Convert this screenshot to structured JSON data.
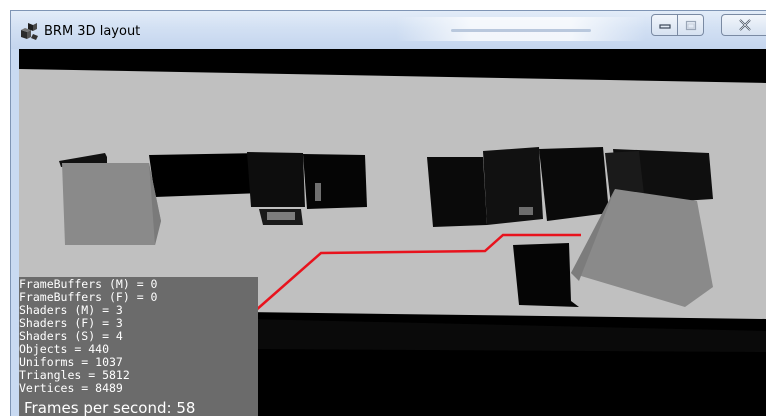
{
  "window": {
    "title": "BRM 3D layout",
    "icon": "brm-app-icon",
    "controls": [
      "minimize-icon",
      "maximize-icon",
      "close-icon"
    ]
  },
  "scene": {
    "description_icon": "3d-scene",
    "path_color": "#e8131d",
    "floor_color": "#c0c0c0",
    "selected_object_color": "#8a8a8a"
  },
  "stats": {
    "lines": [
      "FrameBuffers (M) = 0",
      "FrameBuffers (F) = 0",
      "Shaders (M) = 3",
      "Shaders (F) = 3",
      "Shaders (S) = 4",
      "Objects = 440",
      "Uniforms = 1037",
      "Triangles = 5812",
      "Vertices = 8489"
    ],
    "fps": "Frames per second: 58"
  }
}
